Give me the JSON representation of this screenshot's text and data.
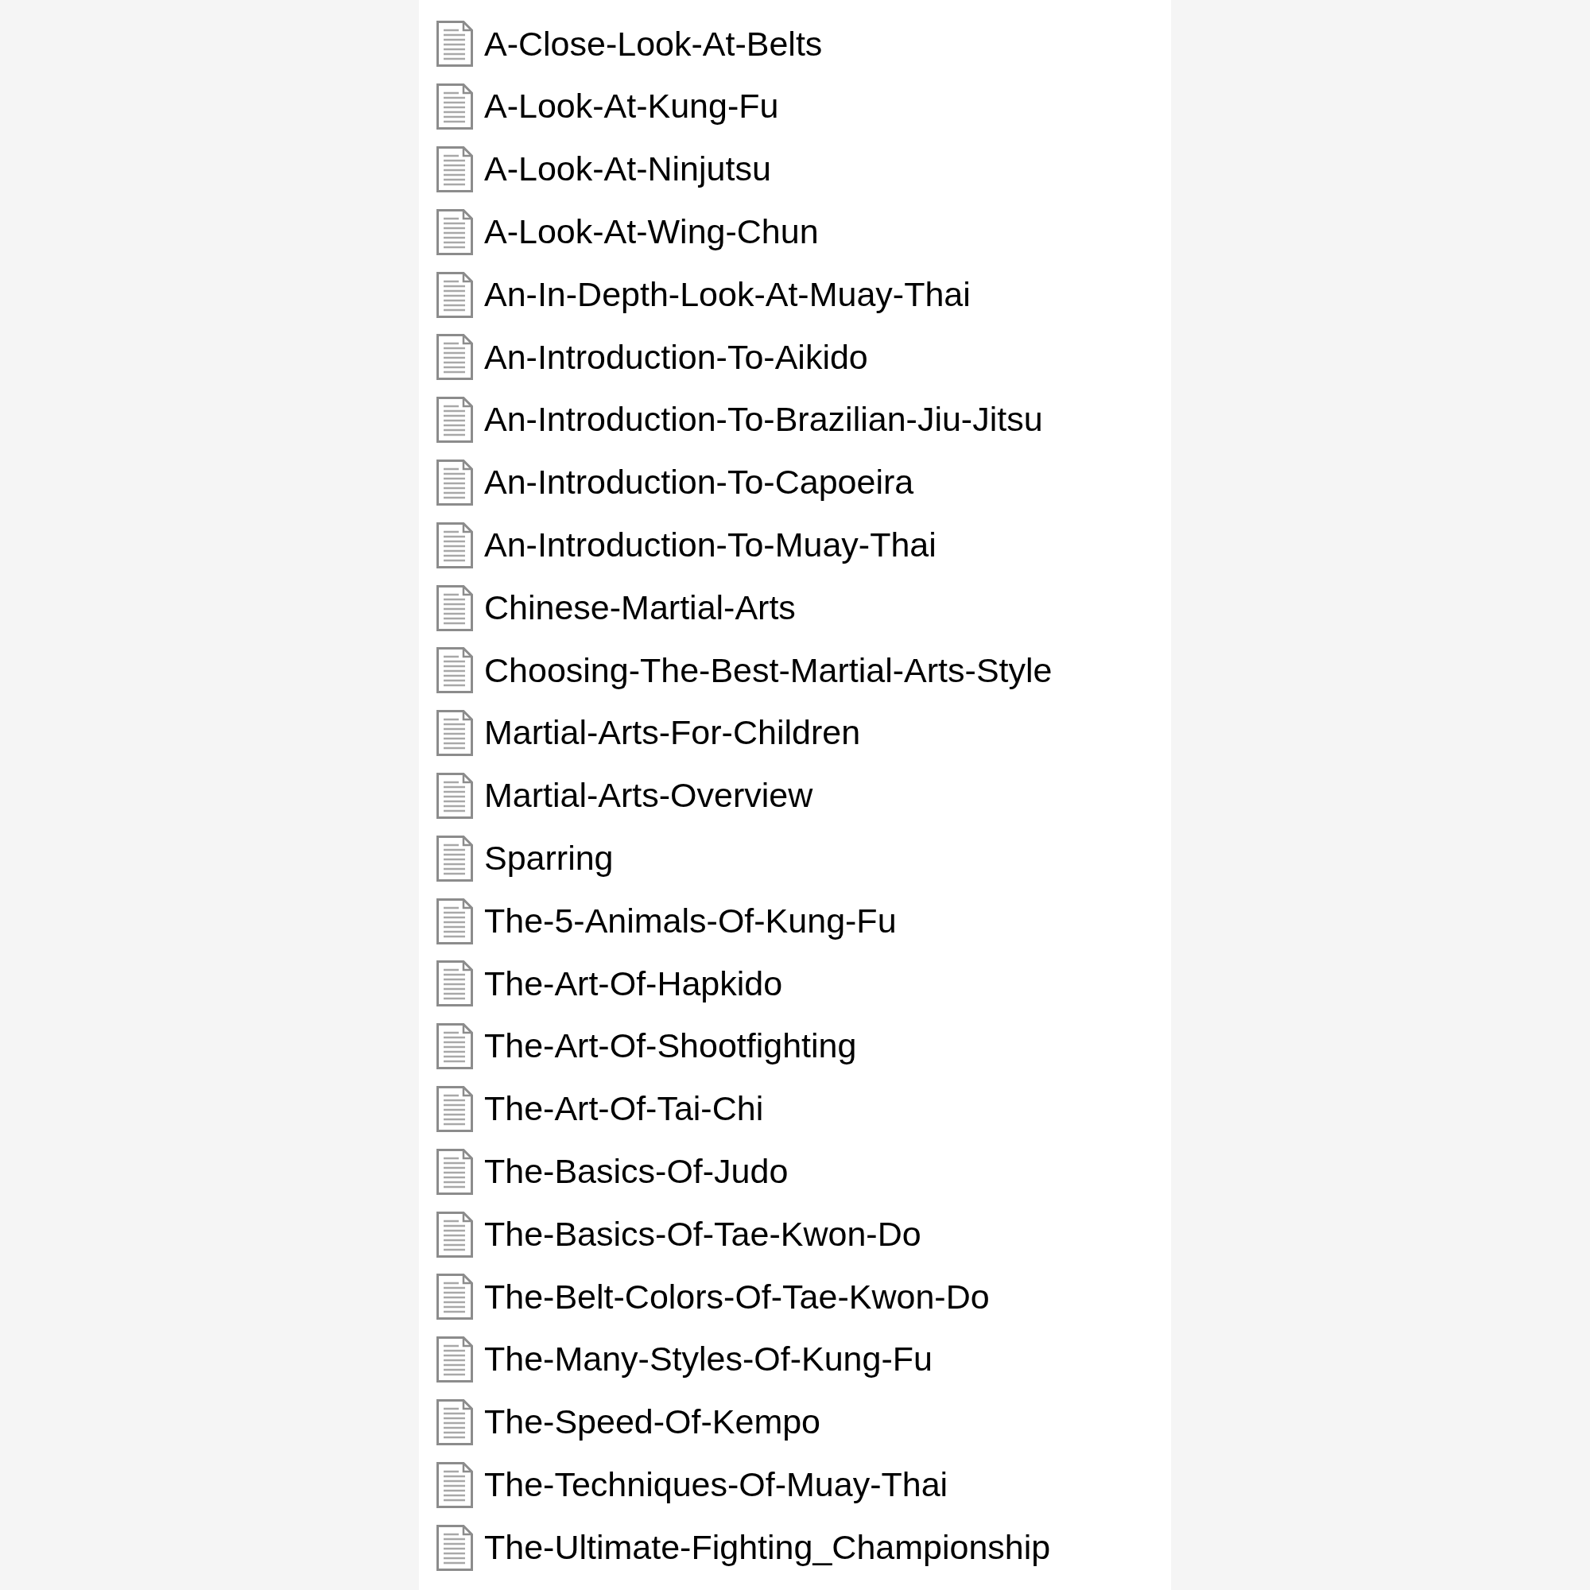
{
  "file_list": {
    "items": [
      {
        "name": "A-Close-Look-At-Belts"
      },
      {
        "name": "A-Look-At-Kung-Fu"
      },
      {
        "name": "A-Look-At-Ninjutsu"
      },
      {
        "name": "A-Look-At-Wing-Chun"
      },
      {
        "name": "An-In-Depth-Look-At-Muay-Thai"
      },
      {
        "name": "An-Introduction-To-Aikido"
      },
      {
        "name": "An-Introduction-To-Brazilian-Jiu-Jitsu"
      },
      {
        "name": "An-Introduction-To-Capoeira"
      },
      {
        "name": "An-Introduction-To-Muay-Thai"
      },
      {
        "name": "Chinese-Martial-Arts"
      },
      {
        "name": "Choosing-The-Best-Martial-Arts-Style"
      },
      {
        "name": "Martial-Arts-For-Children"
      },
      {
        "name": "Martial-Arts-Overview"
      },
      {
        "name": "Sparring"
      },
      {
        "name": "The-5-Animals-Of-Kung-Fu"
      },
      {
        "name": "The-Art-Of-Hapkido"
      },
      {
        "name": "The-Art-Of-Shootfighting"
      },
      {
        "name": "The-Art-Of-Tai-Chi"
      },
      {
        "name": "The-Basics-Of-Judo"
      },
      {
        "name": "The-Basics-Of-Tae-Kwon-Do"
      },
      {
        "name": "The-Belt-Colors-Of-Tae-Kwon-Do"
      },
      {
        "name": "The-Many-Styles-Of-Kung-Fu"
      },
      {
        "name": "The-Speed-Of-Kempo"
      },
      {
        "name": "The-Techniques-Of-Muay-Thai"
      },
      {
        "name": "The-Ultimate-Fighting_Championship"
      }
    ]
  }
}
